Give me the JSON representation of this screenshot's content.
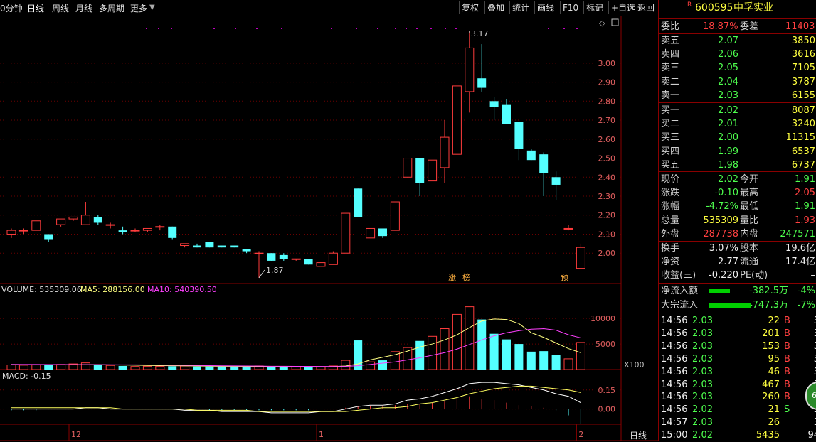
{
  "toolbar": {
    "periods": [
      "0分钟",
      "日线",
      "周线",
      "月线",
      "多周期",
      "更多"
    ],
    "buttons": [
      "复权",
      "叠加",
      "统计",
      "画线",
      "F10",
      "标记",
      "+自选",
      "返回"
    ]
  },
  "stock": {
    "badge": "R",
    "code": "600595",
    "name": "中孚实业"
  },
  "weibi": {
    "label1": "委比",
    "value1": "18.87%",
    "label2": "委差",
    "value2": "11403"
  },
  "sell": [
    {
      "label": "卖五",
      "price": "2.07",
      "vol": "3850"
    },
    {
      "label": "卖四",
      "price": "2.06",
      "vol": "3616"
    },
    {
      "label": "卖三",
      "price": "2.05",
      "vol": "7105"
    },
    {
      "label": "卖二",
      "price": "2.04",
      "vol": "3787"
    },
    {
      "label": "卖一",
      "price": "2.03",
      "vol": "6155"
    }
  ],
  "buy": [
    {
      "label": "买一",
      "price": "2.02",
      "vol": "8087"
    },
    {
      "label": "买二",
      "price": "2.01",
      "vol": "3240"
    },
    {
      "label": "买三",
      "price": "2.00",
      "vol": "11315"
    },
    {
      "label": "买四",
      "price": "1.99",
      "vol": "6537"
    },
    {
      "label": "买五",
      "price": "1.98",
      "vol": "6737"
    }
  ],
  "quote": [
    {
      "l1": "现价",
      "v1": "2.02",
      "l2": "今开",
      "v2": "1.91"
    },
    {
      "l1": "涨跌",
      "v1": "-0.10",
      "l2": "最高",
      "v2": "2.05"
    },
    {
      "l1": "涨幅",
      "v1": "-4.72%",
      "l2": "最低",
      "v2": "1.91"
    },
    {
      "l1": "总量",
      "v1": "535309",
      "l2": "量比",
      "v2": "1.93"
    },
    {
      "l1": "外盘",
      "v1": "287738",
      "l2": "内盘",
      "v2": "247571"
    }
  ],
  "fund": [
    {
      "l1": "换手",
      "v1": "3.07%",
      "l2": "股本",
      "v2": "19.6亿"
    },
    {
      "l1": "净资",
      "v1": "2.77",
      "l2": "流通",
      "v2": "17.4亿"
    },
    {
      "l1": "收益(三)",
      "v1": "-0.220",
      "l2": "PE(动)",
      "v2": "–"
    }
  ],
  "flow": [
    {
      "label": "净流入额",
      "value": "-382.5万",
      "pct": "-4%",
      "fill": 0.3
    },
    {
      "label": "大宗流入",
      "value": "-747.3万",
      "pct": "-7%",
      "fill": 0.6
    }
  ],
  "ticks": [
    {
      "t": "14:56",
      "p": "2.03",
      "v": "22",
      "d": "B",
      "n": "3"
    },
    {
      "t": "14:56",
      "p": "2.03",
      "v": "201",
      "d": "B",
      "n": "3"
    },
    {
      "t": "14:56",
      "p": "2.03",
      "v": "153",
      "d": "B",
      "n": "3"
    },
    {
      "t": "14:56",
      "p": "2.03",
      "v": "95",
      "d": "B",
      "n": "3"
    },
    {
      "t": "14:56",
      "p": "2.03",
      "v": "46",
      "d": "B",
      "n": "3"
    },
    {
      "t": "14:56",
      "p": "2.03",
      "v": "467",
      "d": "B",
      "n": "3"
    },
    {
      "t": "14:56",
      "p": "2.03",
      "v": "260",
      "d": "B",
      "n": "3"
    },
    {
      "t": "14:56",
      "p": "2.02",
      "v": "21",
      "d": "S",
      "n": "3"
    },
    {
      "t": "14:57",
      "p": "2.03",
      "v": "26",
      "d": "",
      "n": "3"
    },
    {
      "t": "15:00",
      "p": "2.02",
      "v": "5435",
      "d": "",
      "n": "94"
    }
  ],
  "bubble": "60",
  "chart_data": {
    "type": "candlestick",
    "price_axis": [
      "3.00",
      "2.90",
      "2.80",
      "2.70",
      "2.60",
      "2.50",
      "2.40",
      "2.30",
      "2.20",
      "2.10",
      "2.00"
    ],
    "ylim": [
      1.84,
      3.22
    ],
    "annotations": {
      "high": "3.17",
      "low": "1.87",
      "tag1": "涨",
      "tag2": "榜",
      "tag3": "预"
    },
    "candles": [
      [
        2.1,
        2.13,
        2.08,
        2.12
      ],
      [
        2.12,
        2.13,
        2.1,
        2.12
      ],
      [
        2.12,
        2.17,
        2.12,
        2.17
      ],
      [
        2.1,
        2.1,
        2.06,
        2.07
      ],
      [
        2.15,
        2.18,
        2.14,
        2.18
      ],
      [
        2.18,
        2.19,
        2.17,
        2.19
      ],
      [
        2.15,
        2.27,
        2.15,
        2.2
      ],
      [
        2.19,
        2.2,
        2.15,
        2.16
      ],
      [
        2.15,
        2.16,
        2.13,
        2.15
      ],
      [
        2.12,
        2.14,
        2.1,
        2.11
      ],
      [
        2.12,
        2.13,
        2.11,
        2.12
      ],
      [
        2.12,
        2.13,
        2.11,
        2.13
      ],
      [
        2.14,
        2.15,
        2.12,
        2.14
      ],
      [
        2.14,
        2.14,
        2.07,
        2.08
      ],
      [
        2.04,
        2.05,
        2.03,
        2.05
      ],
      [
        2.04,
        2.05,
        2.03,
        2.03
      ],
      [
        2.06,
        2.06,
        2.03,
        2.03
      ],
      [
        2.04,
        2.04,
        2.03,
        2.03
      ],
      [
        2.04,
        2.04,
        2.03,
        2.03
      ],
      [
        2.02,
        2.02,
        2.0,
        2.01
      ],
      [
        2.0,
        2.01,
        1.87,
        2.0
      ],
      [
        2.0,
        2.0,
        1.96,
        1.96
      ],
      [
        1.99,
        2.0,
        1.96,
        1.97
      ],
      [
        1.97,
        1.97,
        1.96,
        1.97
      ],
      [
        1.97,
        1.97,
        1.94,
        1.94
      ],
      [
        1.93,
        1.95,
        1.93,
        1.95
      ],
      [
        1.94,
        2.01,
        1.94,
        2.0
      ],
      [
        2.0,
        2.2,
        2.0,
        2.21
      ],
      [
        2.34,
        2.34,
        2.19,
        2.19
      ],
      [
        2.08,
        2.13,
        2.08,
        2.13
      ],
      [
        2.13,
        2.13,
        2.08,
        2.09
      ],
      [
        2.12,
        2.27,
        2.12,
        2.27
      ],
      [
        2.4,
        2.5,
        2.4,
        2.5
      ],
      [
        2.5,
        2.5,
        2.3,
        2.37
      ],
      [
        2.38,
        2.49,
        2.38,
        2.49
      ],
      [
        2.45,
        2.7,
        2.37,
        2.61
      ],
      [
        2.52,
        2.88,
        2.52,
        2.88
      ],
      [
        2.85,
        3.17,
        2.74,
        3.08
      ],
      [
        2.92,
        3.1,
        2.85,
        2.87
      ],
      [
        2.8,
        2.82,
        2.7,
        2.77
      ],
      [
        2.78,
        2.81,
        2.68,
        2.68
      ],
      [
        2.69,
        2.69,
        2.49,
        2.55
      ],
      [
        2.54,
        2.55,
        2.49,
        2.49
      ],
      [
        2.52,
        2.53,
        2.3,
        2.42
      ],
      [
        2.4,
        2.43,
        2.28,
        2.36
      ],
      [
        2.13,
        2.15,
        2.12,
        2.13
      ],
      [
        1.92,
        2.05,
        1.92,
        2.03
      ]
    ],
    "volume_axis": [
      "10000",
      "5000"
    ],
    "volume_unit": "X100",
    "volume_label": {
      "vol": "VOLUME: 535309.06",
      "ma5": "MA5: 288156.00",
      "ma10": "MA10: 540390.50"
    },
    "volumes": [
      900,
      850,
      900,
      900,
      1000,
      1100,
      1300,
      900,
      800,
      700,
      600,
      650,
      650,
      650,
      700,
      600,
      600,
      600,
      600,
      600,
      700,
      600,
      550,
      600,
      500,
      500,
      700,
      1800,
      5700,
      1500,
      1800,
      3500,
      4300,
      5600,
      6500,
      8000,
      10800,
      12300,
      9800,
      7000,
      5900,
      5000,
      3500,
      3600,
      2900,
      2100,
      5300
    ],
    "vol_ma5": [
      1000,
      980,
      970,
      950,
      950,
      950,
      960,
      950,
      900,
      880,
      850,
      800,
      760,
      740,
      730,
      690,
      670,
      650,
      640,
      630,
      620,
      610,
      600,
      600,
      590,
      580,
      590,
      700,
      1100,
      1900,
      2400,
      2900,
      3600,
      4400,
      5000,
      5800,
      6800,
      8200,
      9500,
      9900,
      9800,
      9000,
      7200,
      6300,
      5200,
      4100,
      3300
    ],
    "vol_ma10": [
      1000,
      1000,
      990,
      980,
      970,
      960,
      960,
      950,
      940,
      930,
      920,
      900,
      880,
      860,
      840,
      800,
      760,
      730,
      710,
      690,
      670,
      650,
      640,
      630,
      620,
      610,
      600,
      620,
      750,
      1000,
      1250,
      1500,
      1900,
      2300,
      2800,
      3300,
      4000,
      4900,
      5800,
      6600,
      7200,
      7600,
      7900,
      8000,
      7700,
      6800,
      6200
    ],
    "macd_label": "MACD: -0.15",
    "macd_axis": [
      "0.15",
      "0.00"
    ],
    "macd_ylim": [
      -0.12,
      0.3
    ],
    "macd_hist": [
      -0.01,
      -0.01,
      -0.01,
      0,
      0,
      0,
      0,
      0,
      0,
      0,
      0,
      0,
      0,
      0,
      0,
      0,
      -0.01,
      -0.01,
      -0.01,
      -0.01,
      -0.01,
      -0.01,
      -0.01,
      -0.01,
      -0.01,
      0,
      0,
      0.01,
      0.02,
      0.02,
      0.02,
      0.03,
      0.04,
      0.04,
      0.05,
      0.06,
      0.08,
      0.1,
      0.08,
      0.07,
      0.05,
      0.03,
      0.02,
      0.01,
      -0.01,
      -0.05,
      -0.12
    ],
    "macd_dif": [
      0.0,
      0.0,
      0.0,
      0.0,
      0.0,
      0.0,
      0.01,
      0.01,
      0.0,
      0.0,
      0.0,
      0.0,
      0.0,
      0.0,
      -0.01,
      -0.01,
      -0.01,
      -0.02,
      -0.02,
      -0.02,
      -0.02,
      -0.03,
      -0.03,
      -0.03,
      -0.03,
      -0.02,
      -0.02,
      0.0,
      0.02,
      0.03,
      0.03,
      0.04,
      0.07,
      0.08,
      0.1,
      0.13,
      0.16,
      0.2,
      0.21,
      0.21,
      0.2,
      0.19,
      0.17,
      0.15,
      0.12,
      0.1,
      0.05
    ],
    "macd_dea": [
      0.01,
      0.01,
      0.01,
      0.01,
      0.01,
      0.01,
      0.01,
      0.01,
      0.01,
      0.0,
      0.0,
      0.0,
      0.0,
      0.0,
      0.0,
      -0.01,
      -0.01,
      -0.01,
      -0.01,
      -0.01,
      -0.02,
      -0.02,
      -0.02,
      -0.02,
      -0.02,
      -0.02,
      -0.02,
      -0.02,
      -0.01,
      0.0,
      0.01,
      0.01,
      0.02,
      0.04,
      0.05,
      0.07,
      0.09,
      0.12,
      0.14,
      0.16,
      0.17,
      0.18,
      0.18,
      0.17,
      0.16,
      0.15,
      0.13
    ],
    "x_labels": [
      {
        "label": "12",
        "index": 5
      },
      {
        "label": "1",
        "index": 25
      },
      {
        "label": "2",
        "index": 46
      }
    ],
    "period_label": "日线"
  }
}
